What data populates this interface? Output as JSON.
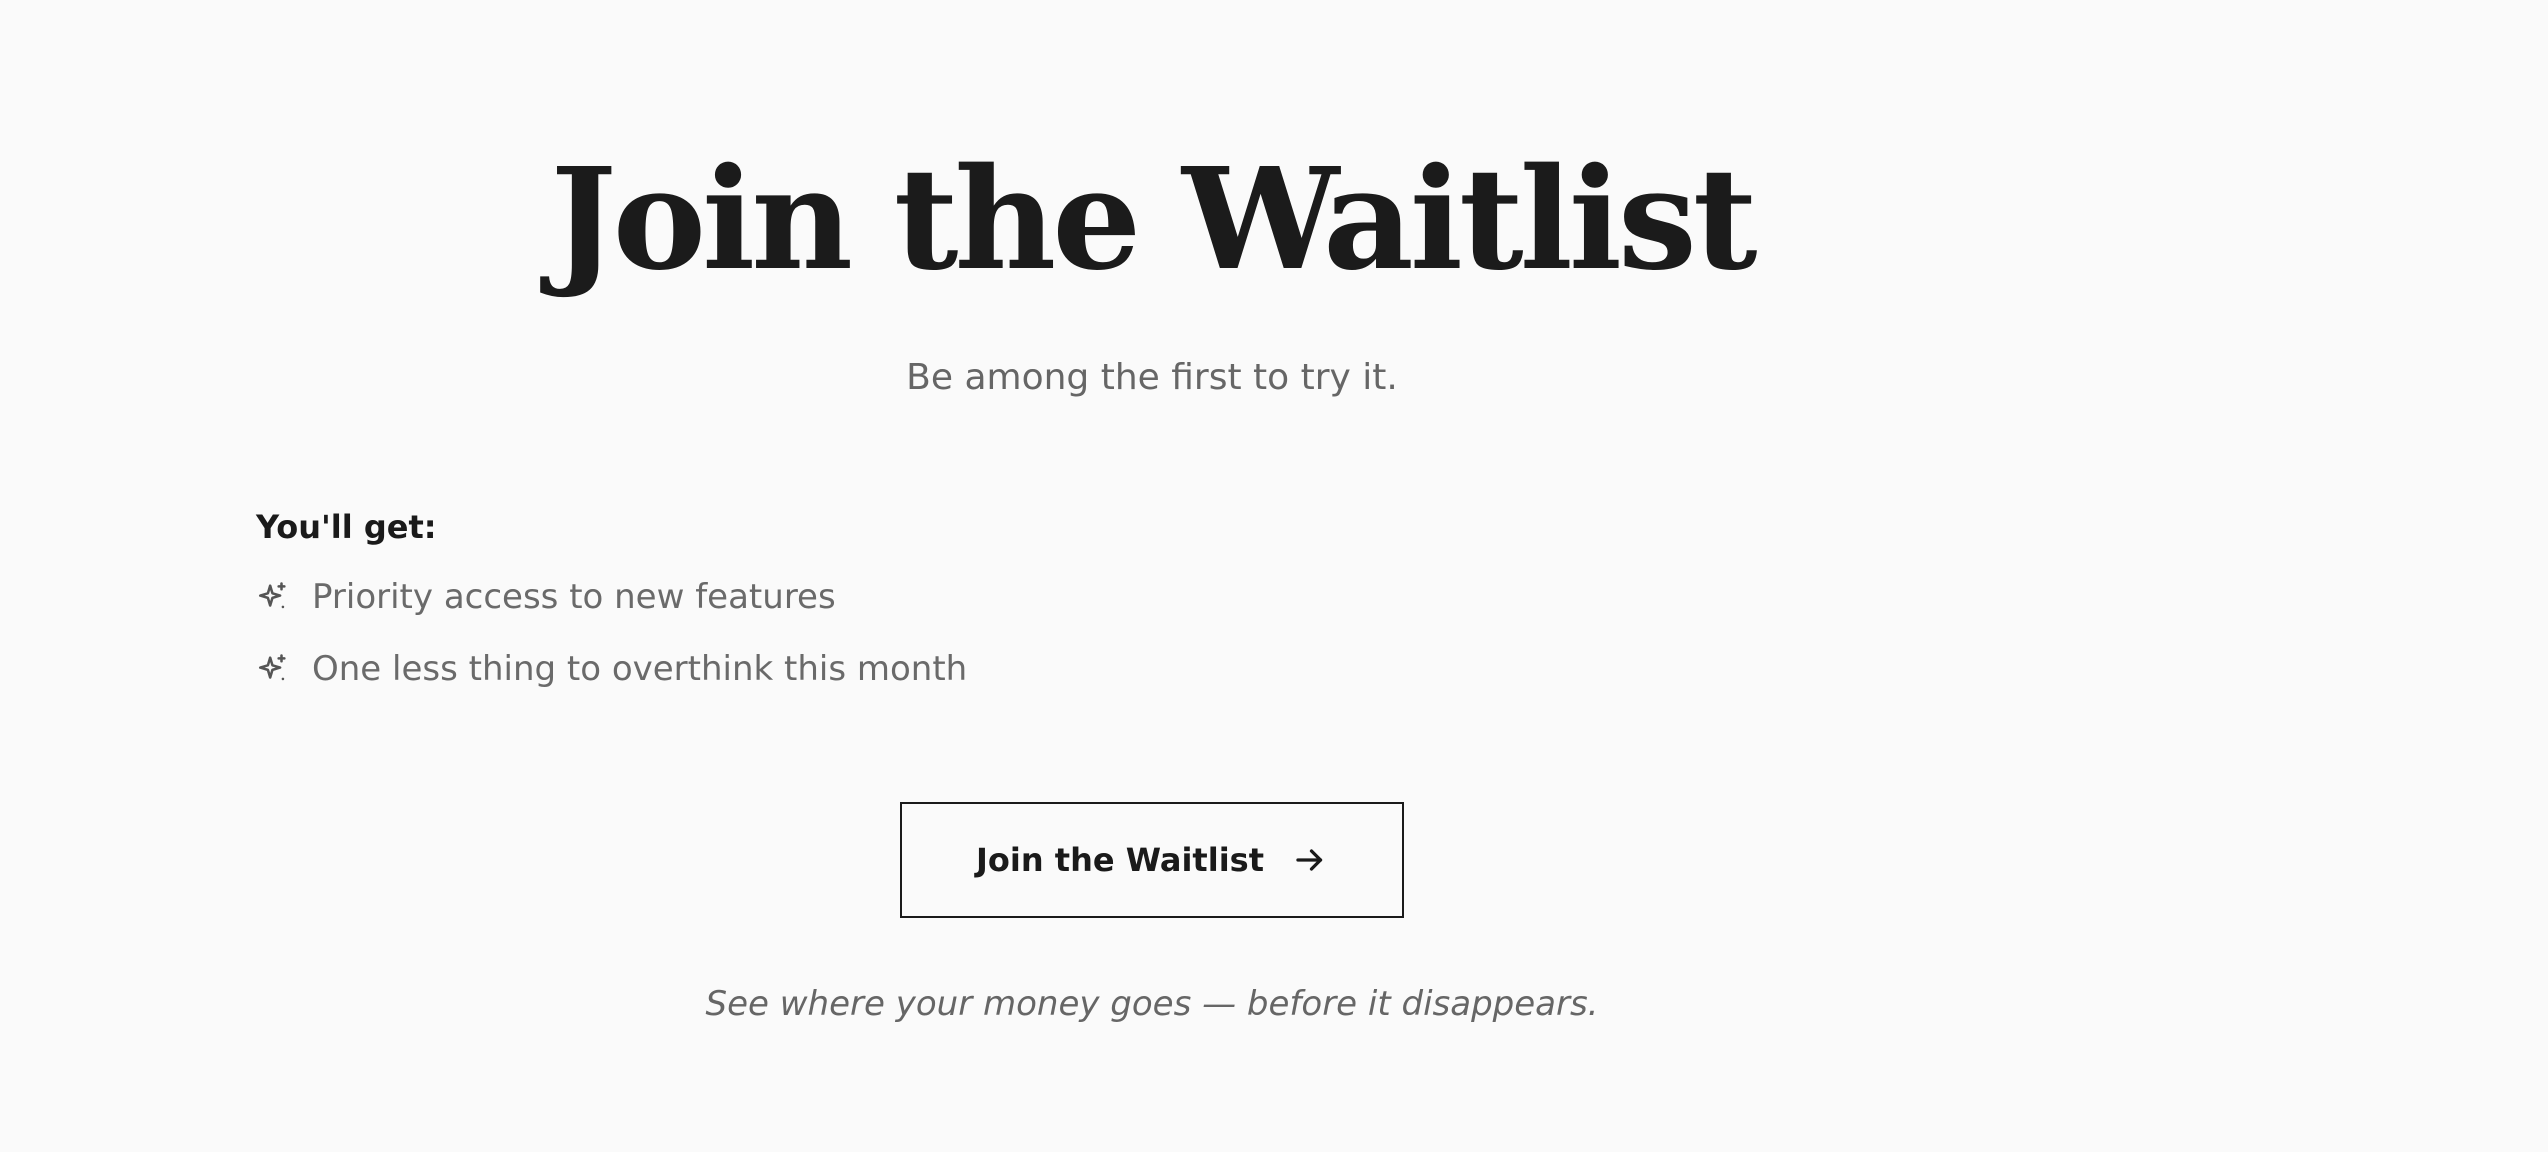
{
  "hero": {
    "title": "Join the Waitlist",
    "subtitle": "Be among the first to try it."
  },
  "benefits": {
    "heading": "You'll get:",
    "icon": "sparkles-icon",
    "items": [
      {
        "label": "Priority access to new features"
      },
      {
        "label": "One less thing to overthink this month"
      }
    ]
  },
  "cta": {
    "label": "Join the Waitlist",
    "icon": "arrow-right-icon"
  },
  "tagline": "See where your money goes — before it disappears.",
  "colors": {
    "background": "#fafafa",
    "text_primary": "#1a1a1a",
    "text_muted": "#666666",
    "button_border": "#1a1a1a"
  }
}
